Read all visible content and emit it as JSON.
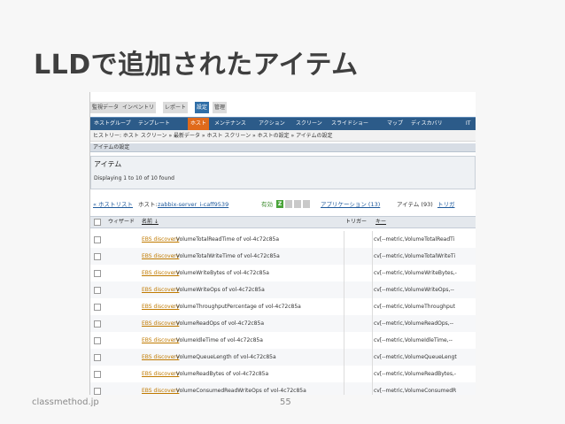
{
  "slide": {
    "title": "LLDで追加されたアイテム",
    "footer_left": "classmethod.jp",
    "page_number": "55"
  },
  "zabbix": {
    "top_tabs": [
      "監視データ",
      "インベントリ",
      "レポート",
      "設定",
      "管理"
    ],
    "menu": [
      "ホストグループ",
      "テンプレート",
      "ホスト",
      "メンテナンス",
      "アクション",
      "スクリーン",
      "スライドショー",
      "マップ",
      "ディスカバリ",
      "IT"
    ],
    "breadcrumb": "ヒストリー:  ホスト スクリーン » 最新データ » ホスト スクリーン » ホストの設定 » アイテムの設定",
    "section_title": "アイテムの設定",
    "page_title": "アイテム",
    "displaying": "Displaying 1 to 10 of 10 found",
    "host_bar": {
      "back": "« ホストリスト",
      "host_label": "ホスト:",
      "host_name": "zabbix-server_i-caff9539",
      "status": "有効",
      "z_badge": "Z",
      "applications": "アプリケーション (13)",
      "items": "アイテム (93)",
      "triggers": "トリガ"
    },
    "columns": {
      "wizard": "ウィザード",
      "name": "名前 ↓",
      "trigger": "トリガー",
      "key": "キー"
    },
    "rows": [
      {
        "prefix": "EBS discovery",
        "name": ": VolumeTotalReadTime of vol-4c72c85a",
        "key": "cv[--metric,VolumeTotalReadTi"
      },
      {
        "prefix": "EBS discovery",
        "name": ": VolumeTotalWriteTime of vol-4c72c85a",
        "key": "cv[--metric,VolumeTotalWriteTi"
      },
      {
        "prefix": "EBS discovery",
        "name": ": VolumeWriteBytes of vol-4c72c85a",
        "key": "cv[--metric,VolumeWriteBytes,-"
      },
      {
        "prefix": "EBS discovery",
        "name": ": VolumeWriteOps of vol-4c72c85a",
        "key": "cv[--metric,VolumeWriteOps,--"
      },
      {
        "prefix": "EBS discovery",
        "name": ": VolumeThroughputPercentage of vol-4c72c85a",
        "key": "cv[--metric,VolumeThroughput"
      },
      {
        "prefix": "EBS discovery",
        "name": ": VolumeReadOps of vol-4c72c85a",
        "key": "cv[--metric,VolumeReadOps,--"
      },
      {
        "prefix": "EBS discovery",
        "name": ": VolumeIdleTime of vol-4c72c85a",
        "key": "cv[--metric,VolumeIdleTime,--"
      },
      {
        "prefix": "EBS discovery",
        "name": ": VolumeQueueLength of vol-4c72c85a",
        "key": "cv[--metric,VolumeQueueLengt"
      },
      {
        "prefix": "EBS discovery",
        "name": ": VolumeReadBytes of vol-4c72c85a",
        "key": "cv[--metric,VolumeReadBytes,-"
      },
      {
        "prefix": "EBS discovery",
        "name": ": VolumeConsumedReadWriteOps of vol-4c72c85a",
        "key": "cv[--metric,VolumeConsumedR"
      }
    ]
  }
}
